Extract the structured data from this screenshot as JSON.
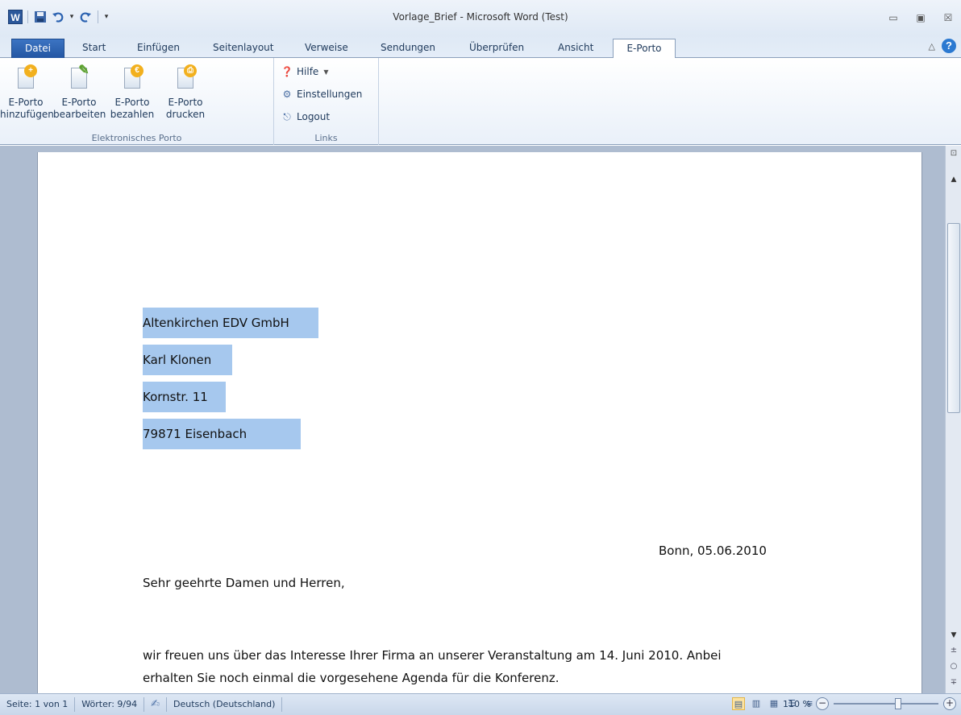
{
  "window": {
    "title": "Vorlage_Brief - Microsoft Word (Test)",
    "app_logo": "W",
    "controls": {
      "minimize": "▭",
      "maximize": "▣",
      "close": "☒"
    }
  },
  "qat": {
    "save_icon": "floppy-icon",
    "undo_icon": "undo-icon",
    "redo_icon": "redo-icon"
  },
  "tabs": [
    {
      "label": "Datei"
    },
    {
      "label": "Start"
    },
    {
      "label": "Einfügen"
    },
    {
      "label": "Seitenlayout"
    },
    {
      "label": "Verweise"
    },
    {
      "label": "Sendungen"
    },
    {
      "label": "Überprüfen"
    },
    {
      "label": "Ansicht"
    },
    {
      "label": "E-Porto"
    }
  ],
  "ribbon": {
    "groups": [
      {
        "label": "Elektronisches Porto",
        "buttons": [
          {
            "line1": "E-Porto",
            "line2": "hinzufügen"
          },
          {
            "line1": "E-Porto",
            "line2": "bearbeiten"
          },
          {
            "line1": "E-Porto",
            "line2": "bezahlen"
          },
          {
            "line1": "E-Porto",
            "line2": "drucken"
          }
        ]
      },
      {
        "label": "Links",
        "buttons": [
          {
            "label": "Hilfe"
          },
          {
            "label": "Einstellungen"
          },
          {
            "label": "Logout"
          }
        ]
      }
    ]
  },
  "document": {
    "address": [
      "Altenkirchen EDV GmbH",
      "Karl Klonen",
      "Kornstr. 11",
      "79871 Eisenbach"
    ],
    "date_line": "Bonn, 05.06.2010",
    "salutation": "Sehr geehrte Damen und Herren,",
    "body_line1": "wir freuen uns über das Interesse Ihrer Firma an unserer Veranstaltung am 14. Juni 2010. Anbei",
    "body_line2": "erhalten Sie noch einmal die vorgesehene Agenda für die Konferenz."
  },
  "status": {
    "page": "Seite: 1 von 1",
    "words": "Wörter: 9/94",
    "language": "Deutsch (Deutschland)",
    "zoom": "110 %"
  },
  "colors": {
    "selection": "#a6c8ee",
    "datei_tab": "#2b579a",
    "doc_background": "#aebcd0"
  }
}
